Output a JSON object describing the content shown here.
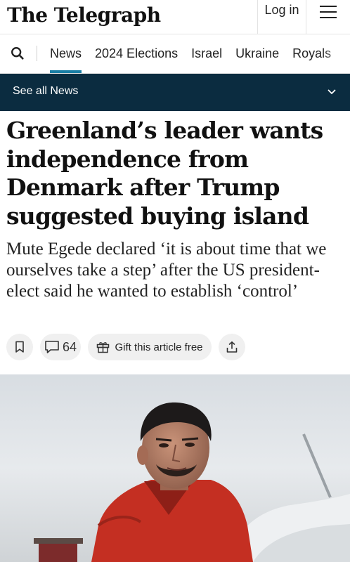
{
  "header": {
    "logo_text": "The Telegraph",
    "login_label": "Log in",
    "menu_icon": "hamburger-menu-icon"
  },
  "nav": {
    "search_icon": "search-icon",
    "items": [
      {
        "label": "News",
        "active": true
      },
      {
        "label": "2024 Elections"
      },
      {
        "label": "Israel"
      },
      {
        "label": "Ukraine"
      },
      {
        "label": "Royals"
      }
    ],
    "accent_color": "#1a7ea5"
  },
  "see_all": {
    "label": "See all News",
    "icon": "chevron-down-icon",
    "background_color": "#0b2c40"
  },
  "article": {
    "headline": "Greenland’s leader wants independence from Denmark after Trump suggested buying island",
    "standfirst": "Mute Egede declared ‘it is about time that we ourselves take a step’ after the US president-elect said he wanted to establish ‘control’"
  },
  "actions": {
    "bookmark_icon": "bookmark-icon",
    "comment_icon": "comment-icon",
    "comment_count": "64",
    "gift_icon": "gift-icon",
    "gift_label": "Gift this article free",
    "share_icon": "share-icon"
  },
  "photo": {
    "subject": "man in red jacket against snowy background"
  }
}
